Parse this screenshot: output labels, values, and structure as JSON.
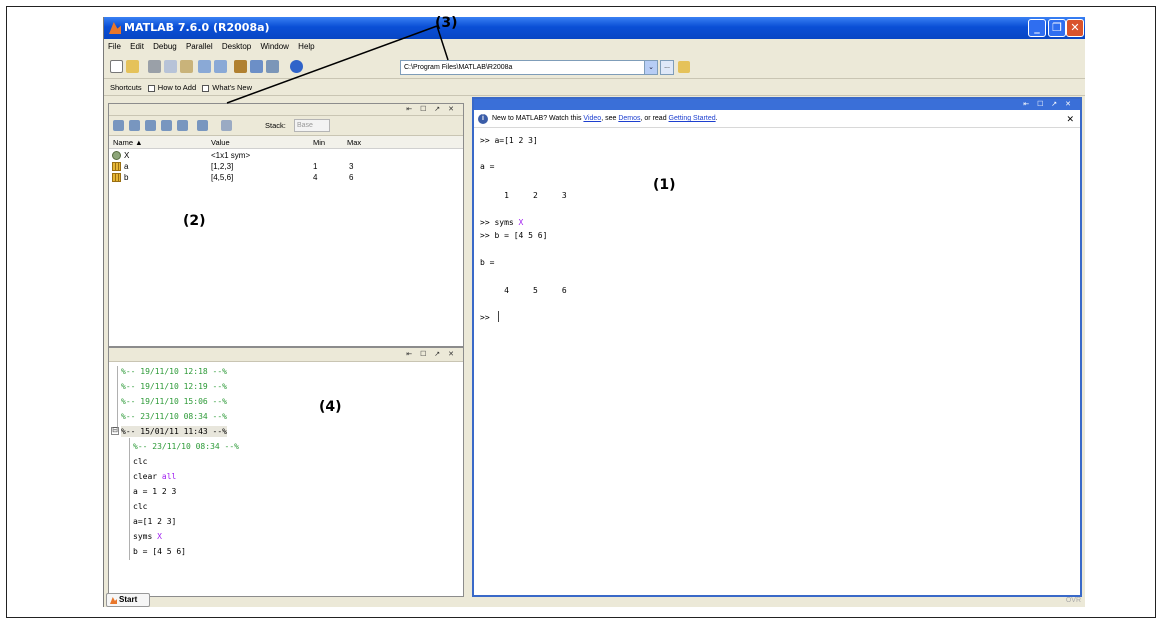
{
  "window": {
    "title": "MATLAB  7.6.0 (R2008a)",
    "minimize": "_",
    "maximize": "❐",
    "close": "✕"
  },
  "menu": [
    "File",
    "Edit",
    "Debug",
    "Parallel",
    "Desktop",
    "Window",
    "Help"
  ],
  "toolbar": {
    "current_directory": "C:\\Program Files\\MATLAB\\R2008a",
    "dropdown_arrow": "⌄",
    "browse_label": "..."
  },
  "shortcuts": {
    "label": "Shortcuts",
    "how_to_add": "How to Add",
    "whats_new": "What's New"
  },
  "workspace": {
    "title_controls": "⇤ ☐ ↗ ✕",
    "stack_label": "Stack:",
    "stack_value": "Base",
    "columns": [
      "Name ▲",
      "Value",
      "Min",
      "Max"
    ],
    "rows": [
      {
        "name": "X",
        "value": "<1x1 sym>",
        "min": "",
        "max": "",
        "icon": "sym-object-icon"
      },
      {
        "name": "a",
        "value": "[1,2,3]",
        "min": "1",
        "max": "3",
        "icon": "matrix-icon"
      },
      {
        "name": "b",
        "value": "[4,5,6]",
        "min": "4",
        "max": "6",
        "icon": "matrix-icon"
      }
    ]
  },
  "history": {
    "title_controls": "⇤ ☐ ↗ ✕",
    "collapsed_sessions": [
      "%-- 19/11/10 12:18 --%",
      "%-- 19/11/10 12:19 --%",
      "%-- 19/11/10 15:06 --%",
      "%-- 23/11/10 08:34 --%"
    ],
    "expanded_session": "%-- 15/01/11 11:43 --%",
    "expander": "⊟",
    "entries": [
      {
        "text": "%-- 23/11/10 08:34 --%",
        "session": true
      },
      {
        "text": "clc"
      },
      {
        "text": "clear ",
        "kw": "all"
      },
      {
        "text": "a = 1 2 3"
      },
      {
        "text": "clc"
      },
      {
        "text": "a=[1 2 3]"
      },
      {
        "text": "syms ",
        "kw": "X"
      },
      {
        "text": "b = [4 5 6]"
      }
    ]
  },
  "command_window": {
    "title_controls": "⇤ ☐ ↗ ✕",
    "info_prefix": "New to MATLAB? Watch this ",
    "info_video": "Video",
    "info_mid1": ", see ",
    "info_demos": "Demos",
    "info_mid2": ", or read ",
    "info_getting_started": "Getting Started",
    "info_suffix": ".",
    "info_close": "✕",
    "lines": {
      "l1": ">> a=[1 2 3]",
      "l2": "a =",
      "l3": "     1     2     3",
      "l4_prefix": ">> syms ",
      "l4_kw": "X",
      "l5": ">> b = [4 5 6]",
      "l6": "b =",
      "l7": "     4     5     6",
      "l8": ">> "
    }
  },
  "statusbar": {
    "start": "Start",
    "ovr": "OVR"
  },
  "annotations": {
    "one": "(1)",
    "two": "(2)",
    "three": "(3)",
    "four": "(4)"
  },
  "colors": {
    "titlebar": "#0a4fd6",
    "session_green": "#2c9a37",
    "keyword_purple": "#a020f0",
    "link_blue": "#1d3fcf",
    "command_border": "#3969c8"
  }
}
